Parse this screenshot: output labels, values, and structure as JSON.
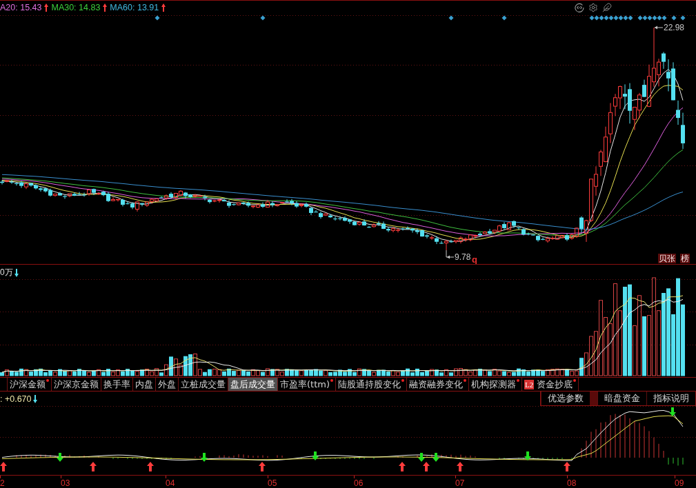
{
  "top_bar": {
    "legend": [
      {
        "label": "A20: 15.43",
        "color": "#e070e0",
        "rising": true
      },
      {
        "label": "MA30: 14.83",
        "color": "#3cd03c",
        "rising": true
      },
      {
        "label": "MA60: 13.91",
        "color": "#40b8e0",
        "rising": true
      }
    ]
  },
  "price_chart": {
    "high_label": "22.98",
    "low_label": "9.78",
    "marker": "q",
    "buttons": [
      "贝张",
      "榜"
    ]
  },
  "volume_panel": {
    "label": "0万",
    "rising": false
  },
  "tabs": [
    {
      "label": "沪深金额",
      "selected": false,
      "dot": true
    },
    {
      "label": "沪深京金额",
      "selected": false,
      "dot": false
    },
    {
      "label": "换手率",
      "selected": false,
      "dot": false
    },
    {
      "label": "内盘",
      "selected": false,
      "dot": false
    },
    {
      "label": "外盘",
      "selected": false,
      "dot": false
    },
    {
      "label": "立桩成交量",
      "selected": false,
      "dot": false
    },
    {
      "label": "盘后成交量",
      "selected": true,
      "dot": false
    },
    {
      "label": "市盈率(ttm)",
      "selected": false,
      "dot": true
    },
    {
      "label": "陆股通持股变化",
      "selected": false,
      "dot": true
    },
    {
      "label": "融资融券变化",
      "selected": false,
      "dot": true
    },
    {
      "label": "机构探测器",
      "selected": false,
      "dot": true
    },
    {
      "label": "资金抄底",
      "badge": "L2",
      "selected": false,
      "dot": true
    }
  ],
  "indicator": {
    "value": ": +0.670",
    "rising": false,
    "buttons": [
      "优选参数",
      "暗盘资金",
      "指标说明"
    ]
  },
  "x_axis": {
    "labels": [
      "2",
      "03",
      "04",
      "05",
      "06",
      "07",
      "08",
      "09"
    ]
  }
}
